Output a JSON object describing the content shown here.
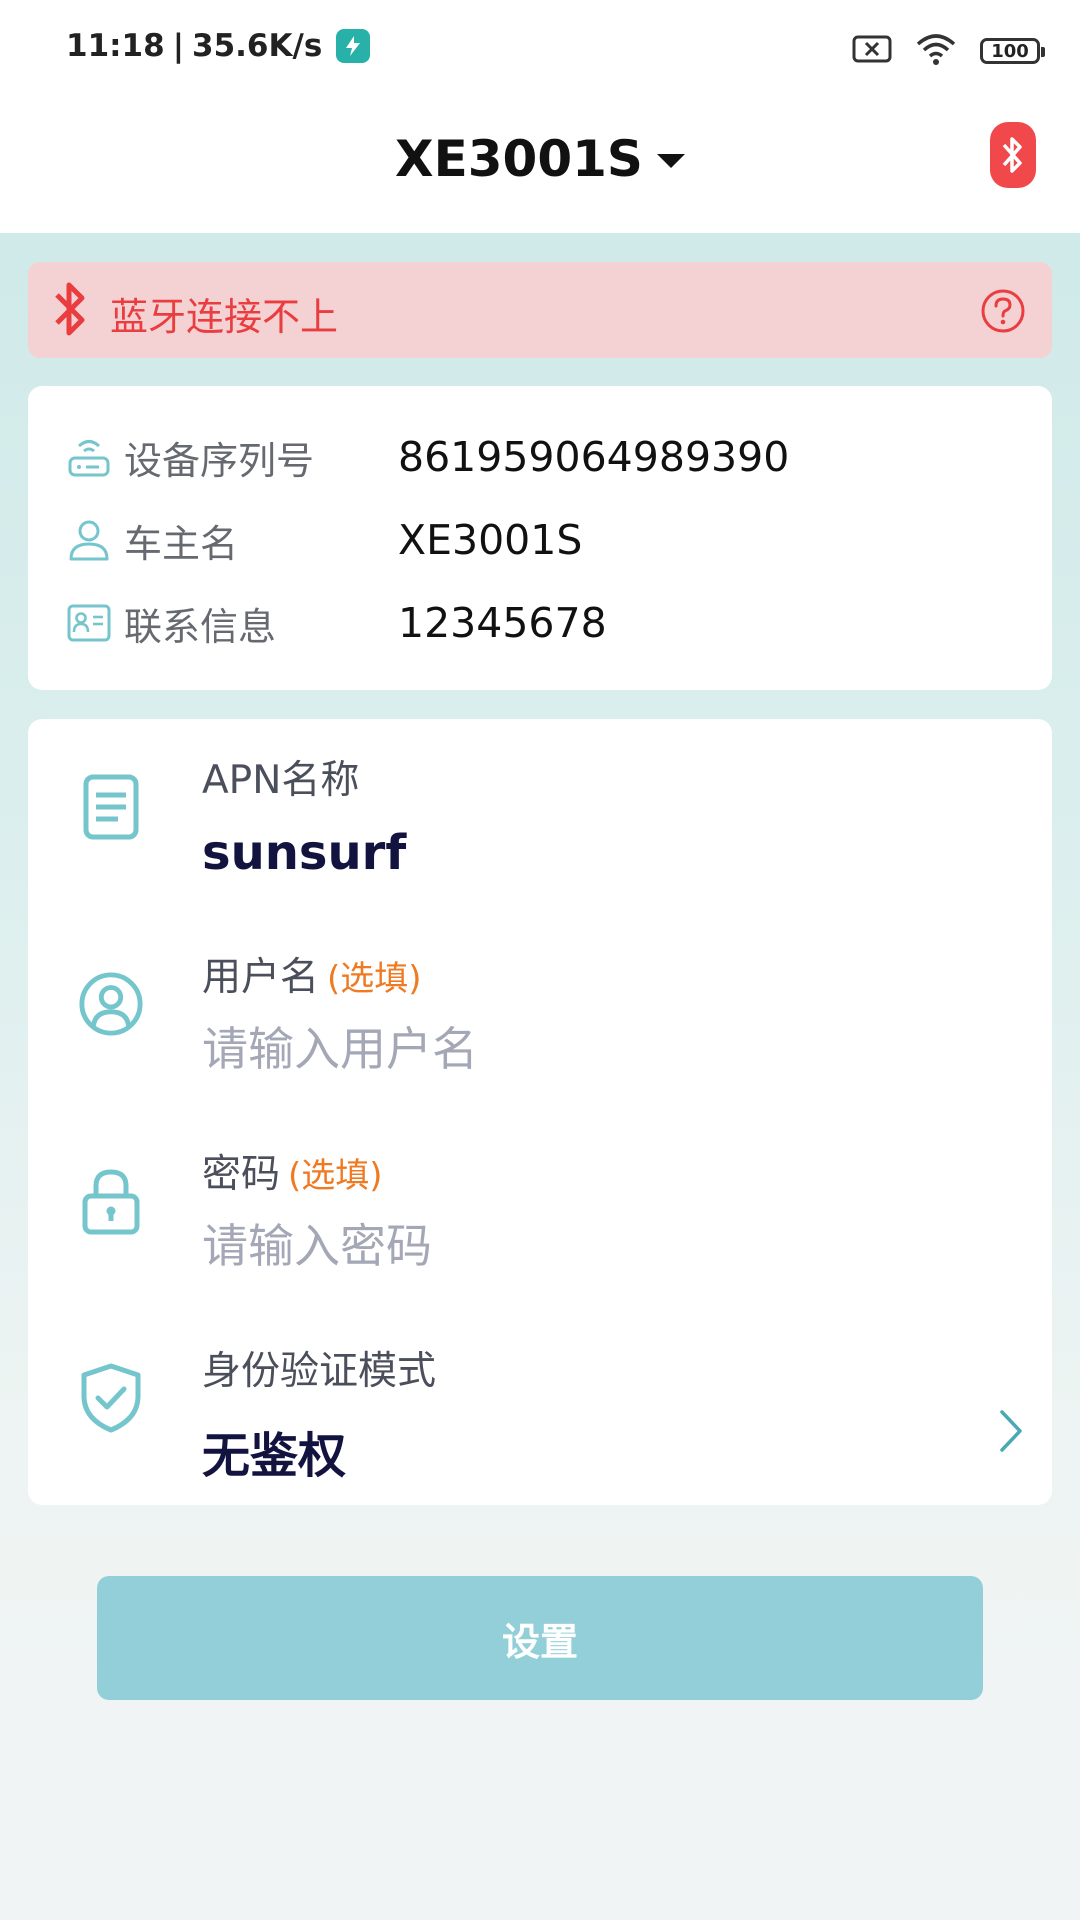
{
  "status_bar": {
    "time": "11:18",
    "speed": "35.6K/s",
    "battery": "100"
  },
  "header": {
    "device_name": "XE3001S"
  },
  "alert": {
    "text": "蓝牙连接不上"
  },
  "device_info": [
    {
      "label": "设备序列号",
      "value": "861959064989390",
      "icon": "router-icon"
    },
    {
      "label": "车主名",
      "value": "XE3001S",
      "icon": "user-icon"
    },
    {
      "label": "联系信息",
      "value": "12345678",
      "icon": "contact-card-icon"
    }
  ],
  "form": {
    "apn": {
      "label": "APN名称",
      "value": "sunsurf"
    },
    "username": {
      "label": "用户名",
      "optional": "(选填)",
      "placeholder": "请输入用户名",
      "value": ""
    },
    "password": {
      "label": "密码",
      "optional": "(选填)",
      "placeholder": "请输入密码",
      "value": ""
    },
    "auth": {
      "label": "身份验证模式",
      "value": "无鉴权"
    }
  },
  "actions": {
    "submit_label": "设置"
  },
  "colors": {
    "accent": "#74c6cc",
    "alert_text": "#ea3d3f",
    "alert_bg": "#f4d2d3",
    "optional_text": "#ef7a22",
    "button_bg": "#93cfd9"
  }
}
